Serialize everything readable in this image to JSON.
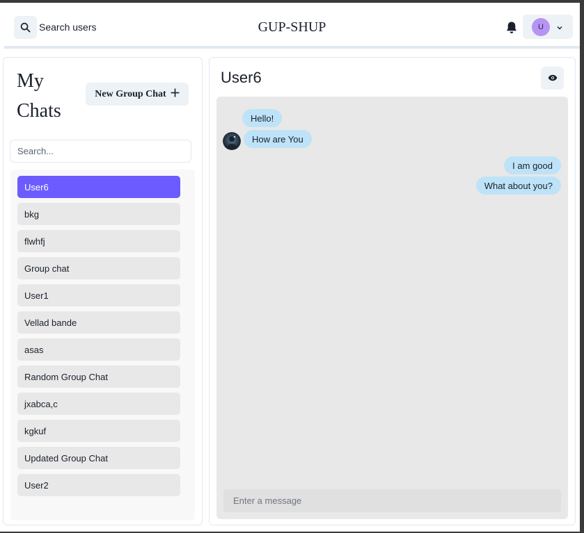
{
  "header": {
    "search_label": "Search users",
    "app_title": "GUP-SHUP",
    "avatar_initial": "U"
  },
  "sidebar": {
    "title_line1": "My",
    "title_line2": "Chats",
    "new_group_label": "New Group Chat",
    "search_placeholder": "Search...",
    "chats": [
      {
        "name": "User6",
        "active": true
      },
      {
        "name": "bkg"
      },
      {
        "name": "flwhfj"
      },
      {
        "name": "Group chat"
      },
      {
        "name": "User1"
      },
      {
        "name": "Vellad bande"
      },
      {
        "name": "asas"
      },
      {
        "name": "Random Group Chat"
      },
      {
        "name": "jxabca,c"
      },
      {
        "name": "kgkuf"
      },
      {
        "name": "Updated Group Chat"
      },
      {
        "name": "User2"
      }
    ]
  },
  "chat": {
    "title": "User6",
    "messages": [
      {
        "text": "Hello!",
        "from": "other"
      },
      {
        "text": "How are You",
        "from": "other"
      },
      {
        "text": "I am good",
        "from": "me"
      },
      {
        "text": "What about you?",
        "from": "me"
      }
    ],
    "input_placeholder": "Enter a message"
  },
  "colors": {
    "accent": "#6c5cff",
    "bubble": "#bee3f8",
    "avatar": "#b794f4"
  }
}
